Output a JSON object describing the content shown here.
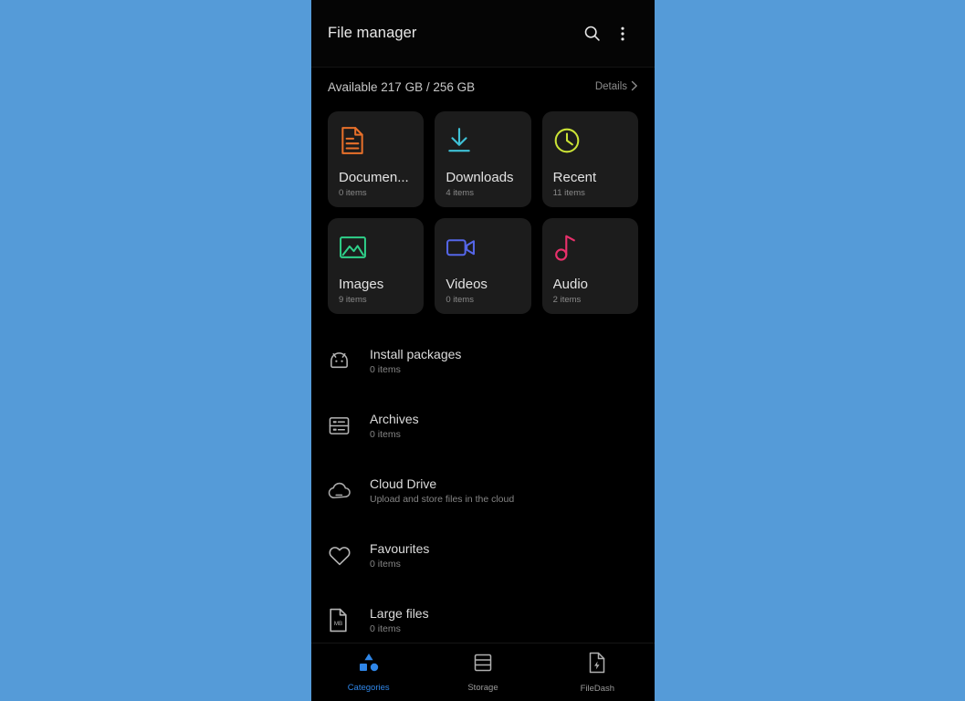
{
  "theme": {
    "backdrop": "#559bd8",
    "phone_bg": "#000000",
    "tile_bg": "#1c1c1c",
    "accent": "#2f86e8"
  },
  "header": {
    "title": "File manager",
    "search_icon": "search-icon",
    "overflow_icon": "more-vertical-icon"
  },
  "storage": {
    "summary": "Available 217 GB / 256 GB",
    "details_label": "Details",
    "chevron": "›"
  },
  "tiles": [
    {
      "label": "Documen...",
      "count": "0 items",
      "icon": "document-icon",
      "color": "#e8702a"
    },
    {
      "label": "Downloads",
      "count": "4 items",
      "icon": "download-icon",
      "color": "#3fc1d6"
    },
    {
      "label": "Recent",
      "count": "11 items",
      "icon": "clock-icon",
      "color": "#cbe336"
    },
    {
      "label": "Images",
      "count": "9 items",
      "icon": "image-icon",
      "color": "#2fd18a"
    },
    {
      "label": "Videos",
      "count": "0 items",
      "icon": "video-icon",
      "color": "#5566e8"
    },
    {
      "label": "Audio",
      "count": "2 items",
      "icon": "music-note-icon",
      "color": "#e8306b"
    }
  ],
  "list": [
    {
      "label": "Install packages",
      "sub": "0 items",
      "icon": "android-icon"
    },
    {
      "label": "Archives",
      "sub": "0 items",
      "icon": "archive-icon"
    },
    {
      "label": "Cloud Drive",
      "sub": "Upload and store files in the cloud",
      "icon": "cloud-icon"
    },
    {
      "label": "Favourites",
      "sub": "0 items",
      "icon": "heart-icon"
    },
    {
      "label": "Large files",
      "sub": "0 items",
      "icon": "large-file-icon",
      "badge": "MB"
    }
  ],
  "bottom_nav": [
    {
      "label": "Categories",
      "icon": "categories-icon",
      "active": true
    },
    {
      "label": "Storage",
      "icon": "storage-stack-icon",
      "active": false
    },
    {
      "label": "FileDash",
      "icon": "filedash-icon",
      "active": false
    }
  ]
}
